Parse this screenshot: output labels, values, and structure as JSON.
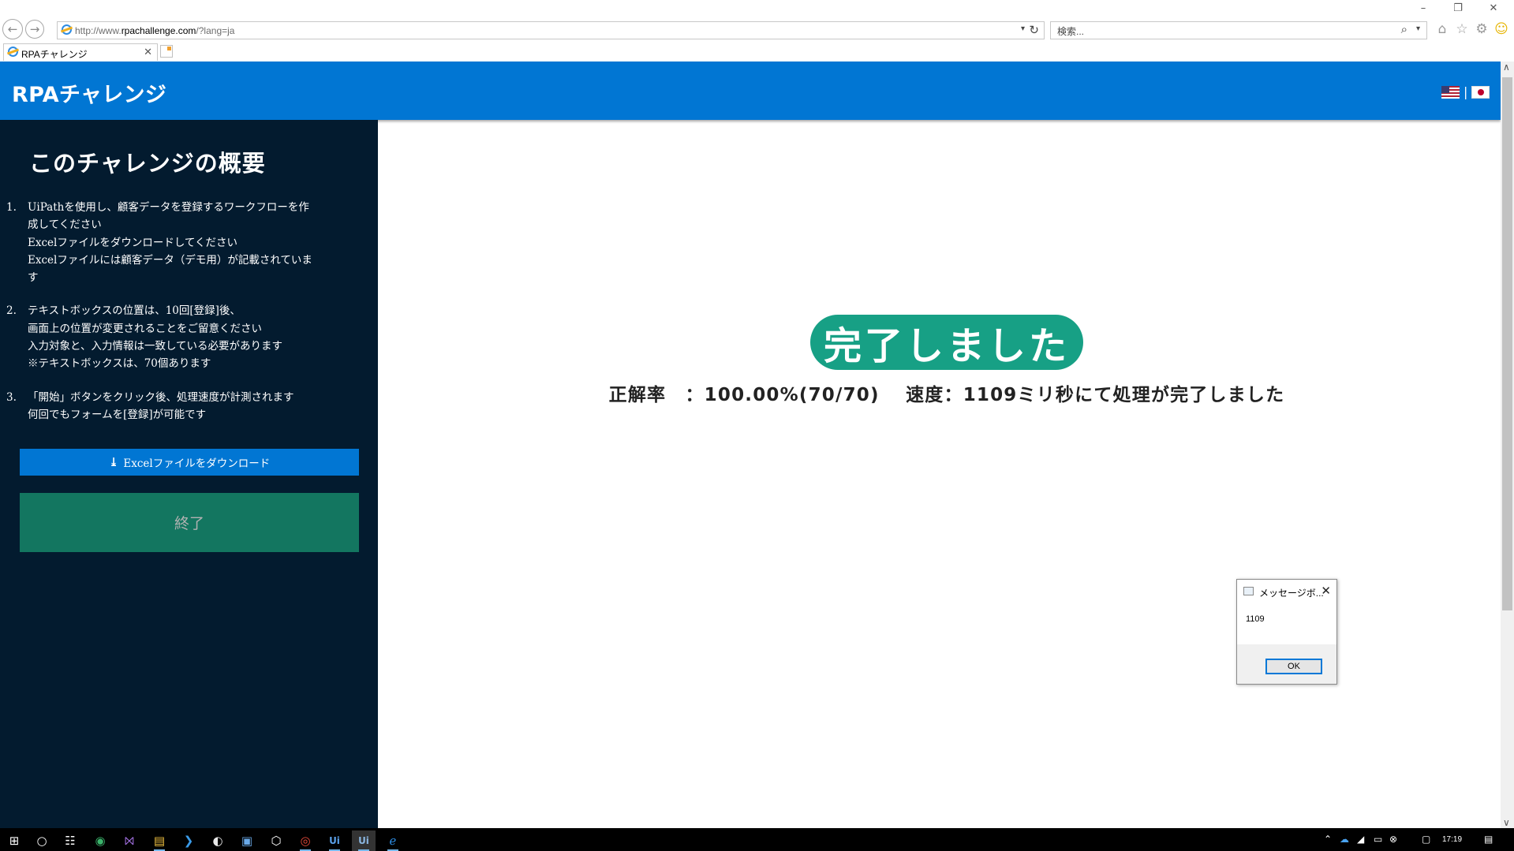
{
  "browser": {
    "url_prefix": "http://www.",
    "url_domain": "rpachallenge.com",
    "url_suffix": "/?lang=ja",
    "search_placeholder": "検索...",
    "tab_title": "RPAチャレンジ",
    "back_icon": "back-arrow-icon",
    "forward_icon": "forward-arrow-icon"
  },
  "header": {
    "brand": "RPAチャレンジ",
    "flag_separator": "|",
    "flags": [
      "us-flag-icon",
      "jp-flag-icon"
    ]
  },
  "sidebar": {
    "title": "このチャレンジの概要",
    "steps": [
      {
        "num": "1.",
        "lines": [
          "UiPathを使用し、顧客データを登録するワークフローを作",
          "成してください",
          "Excelファイルをダウンロードしてください",
          "Excelファイルには顧客データ（デモ用）が記載されていま",
          "す"
        ]
      },
      {
        "num": "2.",
        "lines": [
          "テキストボックスの位置は、10回[登録]後、",
          "画面上の位置が変更されることをご留意ください",
          "入力対象と、入力情報は一致している必要があります",
          "※テキストボックスは、70個あります"
        ]
      },
      {
        "num": "3.",
        "lines": [
          "「開始」ボタンをクリック後、処理速度が計測されます",
          "何回でもフォームを[登録]が可能です"
        ]
      }
    ],
    "download_button": "Excelファイルをダウンロード",
    "end_button": "終了"
  },
  "main": {
    "done_label": "完了しました",
    "result_text": "正解率　：100.00%(70/70)　 速度：1109ミリ秒にて処理が完了しました"
  },
  "message_box": {
    "title": "メッセージボ...",
    "text": "1109",
    "ok_button": "OK"
  },
  "taskbar": {
    "clock": "17:19"
  },
  "colors": {
    "header_blue": "#0176d3",
    "sidebar_navy": "#031b2f",
    "end_button_green": "#137660",
    "done_pill_green": "#17a085"
  }
}
